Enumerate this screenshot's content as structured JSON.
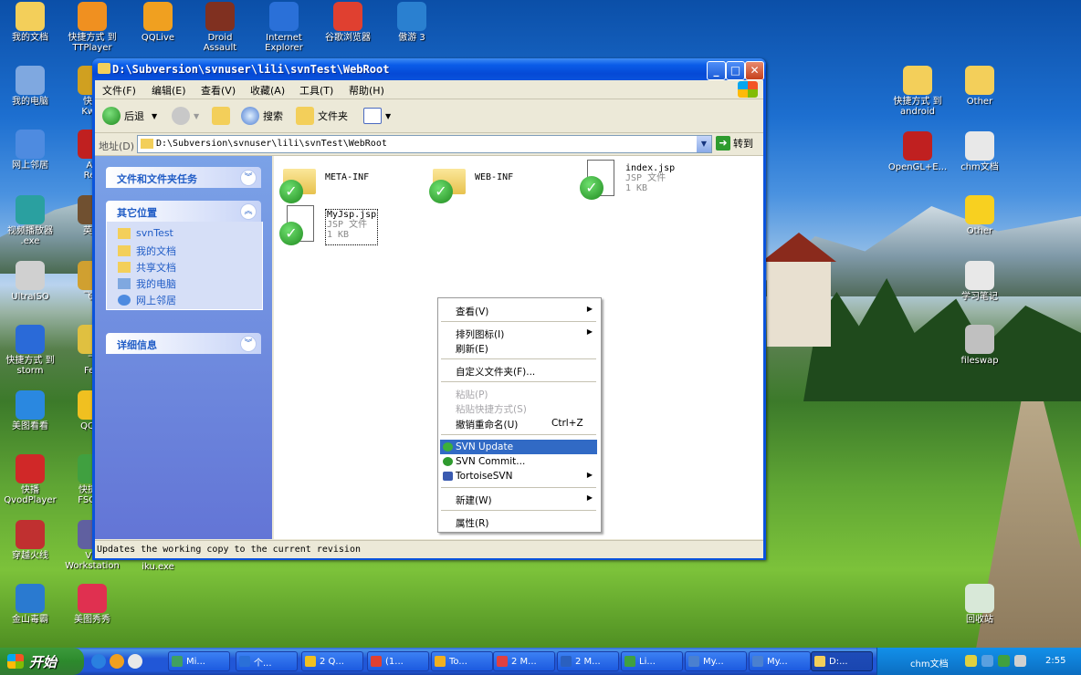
{
  "desktop_left": [
    {
      "label": "我的文档",
      "color": "#f3cf5a"
    },
    {
      "label": "我的电脑",
      "color": "#7fa8e0"
    },
    {
      "label": "网上邻居",
      "color": "#4e8be0"
    },
    {
      "label": "视频播放器\n.exe",
      "color": "#2aa0a0"
    },
    {
      "label": "UltraISO",
      "color": "#d0d0d0"
    },
    {
      "label": "快捷方式 到\nstorm",
      "color": "#2a6ad8"
    },
    {
      "label": "美图看看",
      "color": "#2a88e0"
    },
    {
      "label": "快播\nQvodPlayer",
      "color": "#d02828"
    },
    {
      "label": "穿越火线",
      "color": "#c03030"
    },
    {
      "label": "金山毒霸",
      "color": "#2a7ad0"
    }
  ],
  "desktop_col2": [
    {
      "label": "快捷方式 到\nTTPlayer",
      "color": "#f09020"
    },
    {
      "label": "快捷\nKwM",
      "color": "#d0a020"
    },
    {
      "label": "Ad\nRea",
      "color": "#c02020"
    },
    {
      "label": "英雄",
      "color": "#705030"
    },
    {
      "label": "飞鸽",
      "color": "#d0a030"
    },
    {
      "label": "飞\nFeit",
      "color": "#e0c040"
    },
    {
      "label": "QQ音",
      "color": "#f0c020"
    },
    {
      "label": "快捷方\nFSCap",
      "color": "#40a040"
    },
    {
      "label": "VM\nWorkstation",
      "color": "#6060a0"
    },
    {
      "label": "美图秀秀",
      "color": "#e03050"
    }
  ],
  "desktop_top": [
    {
      "label": "QQLive",
      "color": "#f0a020"
    },
    {
      "label": "Droid\nAssault",
      "color": "#803020"
    },
    {
      "label": "Internet\nExplorer",
      "color": "#2a70d8"
    },
    {
      "label": "谷歌浏览器",
      "color": "#e04030"
    },
    {
      "label": "傲游 3",
      "color": "#2a80d0"
    }
  ],
  "desktop_right": [
    {
      "label": "快捷方式 到\nandroid",
      "color": "#f3cf5a"
    },
    {
      "label": "Other",
      "color": "#f3cf5a"
    },
    {
      "label": "OpenGL+E...",
      "color": "#c02020"
    },
    {
      "label": "chm文档",
      "color": "#e8e8e8"
    },
    {
      "label": "Other",
      "color": "#f8d020"
    },
    {
      "label": "学习笔记",
      "color": "#e8e8e8"
    },
    {
      "label": "fileswap",
      "color": "#c0c0c0"
    },
    {
      "label": "回收站",
      "color": "#d8e8d8"
    }
  ],
  "iku": "iku.exe",
  "window": {
    "title": "D:\\Subversion\\svnuser\\lili\\svnTest\\WebRoot",
    "menu": [
      "文件(F)",
      "编辑(E)",
      "查看(V)",
      "收藏(A)",
      "工具(T)",
      "帮助(H)"
    ],
    "toolbar": {
      "back": "后退",
      "search": "搜索",
      "folders": "文件夹"
    },
    "address_label": "地址(D)",
    "address_value": "D:\\Subversion\\svnuser\\lili\\svnTest\\WebRoot",
    "go": "转到",
    "tasks_title": "文件和文件夹任务",
    "other_title": "其它位置",
    "other_links": [
      "svnTest",
      "我的文档",
      "共享文档",
      "我的电脑",
      "网上邻居"
    ],
    "details_title": "详细信息",
    "files": [
      {
        "name": "META-INF",
        "type": "folder"
      },
      {
        "name": "WEB-INF",
        "type": "folder"
      },
      {
        "name": "index.jsp",
        "kind": "JSP 文件",
        "size": "1 KB"
      },
      {
        "name": "MyJsp.jsp",
        "kind": "JSP 文件",
        "size": "1 KB"
      }
    ],
    "status": "Updates the working copy to the current revision"
  },
  "context_menu": {
    "view": "查看(V)",
    "arrange": "排列图标(I)",
    "refresh": "刷新(E)",
    "customize": "自定义文件夹(F)...",
    "paste": "粘贴(P)",
    "paste_shortcut": "粘贴快捷方式(S)",
    "undo": "撤销重命名(U)",
    "undo_key": "Ctrl+Z",
    "svn_update": "SVN Update",
    "svn_commit": "SVN Commit...",
    "tortoise": "TortoiseSVN",
    "new": "新建(W)",
    "properties": "属性(R)"
  },
  "taskbar": {
    "start": "开始",
    "tasks": [
      "Mi...",
      "个...",
      "2 Q...",
      "(1...",
      "To...",
      "2 M...",
      "2 M...",
      "Li...",
      "My...",
      "My...",
      "D:..."
    ],
    "tray_label": "chm文档",
    "clock": "2:55"
  }
}
